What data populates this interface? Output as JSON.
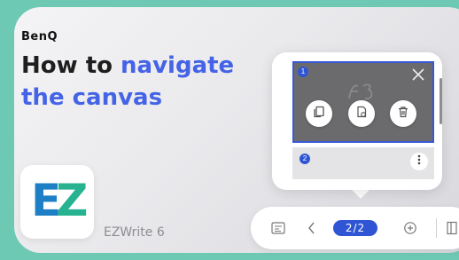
{
  "brand": "BenQ",
  "headline": {
    "part1": "How to ",
    "accent": "navigate",
    "part2": "the canvas"
  },
  "app": {
    "logo_letters": [
      "E",
      "Z"
    ],
    "name": "EZWrite 6"
  },
  "page_popup": {
    "pages": [
      {
        "number": "1",
        "selected": true,
        "actions": [
          "copy-page-icon",
          "export-page-icon",
          "delete-page-icon"
        ]
      },
      {
        "number": "2",
        "selected": false
      }
    ]
  },
  "toolbar": {
    "page_indicator": "2/2"
  },
  "colors": {
    "background": "#6ec9b4",
    "accent_blue": "#4463e6",
    "pill_blue": "#2f55d4",
    "logo_blue": "#1f7fc6",
    "logo_green": "#27b38f"
  }
}
